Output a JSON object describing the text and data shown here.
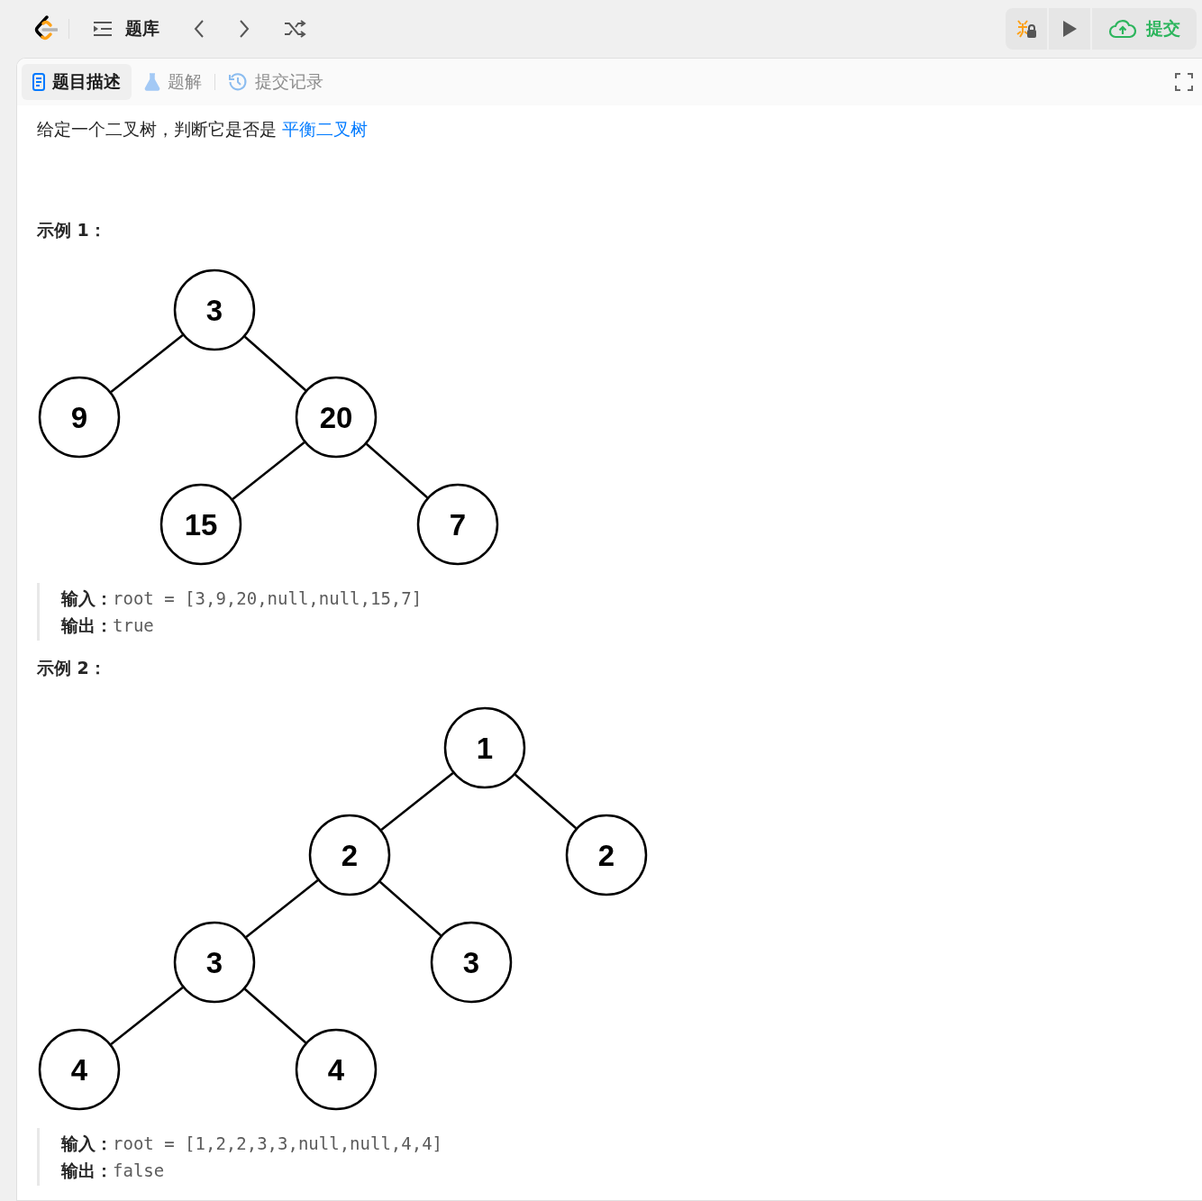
{
  "top_bar": {
    "problem_list_label": "题库",
    "submit_label": "提交"
  },
  "tabs": [
    {
      "label": "题目描述",
      "selected": true,
      "kind": "description"
    },
    {
      "label": "题解",
      "selected": false,
      "kind": "solutions"
    },
    {
      "label": "提交记录",
      "selected": false,
      "kind": "submissions"
    }
  ],
  "description": {
    "text": "给定一个二叉树，判断它是否是 ",
    "link": "平衡二叉树"
  },
  "examples": [
    {
      "title": "示例 1：",
      "tree": {
        "value": "3",
        "children": [
          {
            "value": "9"
          },
          {
            "value": "20",
            "children": [
              {
                "value": "15"
              },
              {
                "value": "7"
              }
            ]
          }
        ]
      },
      "input_label": "输入：",
      "input_value": "root = [3,9,20,null,null,15,7]",
      "output_label": "输出：",
      "output_value": "true"
    },
    {
      "title": "示例 2：",
      "tree": {
        "value": "1",
        "children": [
          {
            "value": "2",
            "children": [
              {
                "value": "3",
                "children": [
                  {
                    "value": "4"
                  },
                  {
                    "value": "4"
                  }
                ]
              },
              {
                "value": "3"
              }
            ]
          },
          {
            "value": "2"
          }
        ]
      },
      "input_label": "输入：",
      "input_value": "root = [1,2,2,3,3,null,null,4,4]",
      "output_label": "输出：",
      "output_value": "false"
    }
  ]
}
